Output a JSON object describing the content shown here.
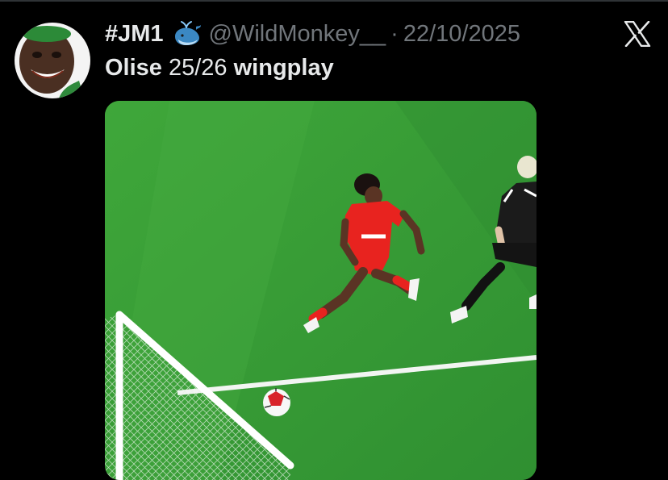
{
  "tweet": {
    "author": {
      "display_name": "#JM1",
      "badge_icon": "whale-emoji-icon",
      "handle": "@WildMonkey__",
      "separator": "·",
      "timestamp": "22/10/2025"
    },
    "text": {
      "part1": "Olise",
      "part2": " 25/26 ",
      "part3": "wingplay"
    },
    "media": {
      "type": "video-still",
      "description_icon": "football-match-image"
    }
  },
  "colors": {
    "background": "#000000",
    "text_primary": "#e7e9ea",
    "text_secondary": "#71767b",
    "pitch_green": "#3f9a3a",
    "kit_red": "#e8231f"
  }
}
